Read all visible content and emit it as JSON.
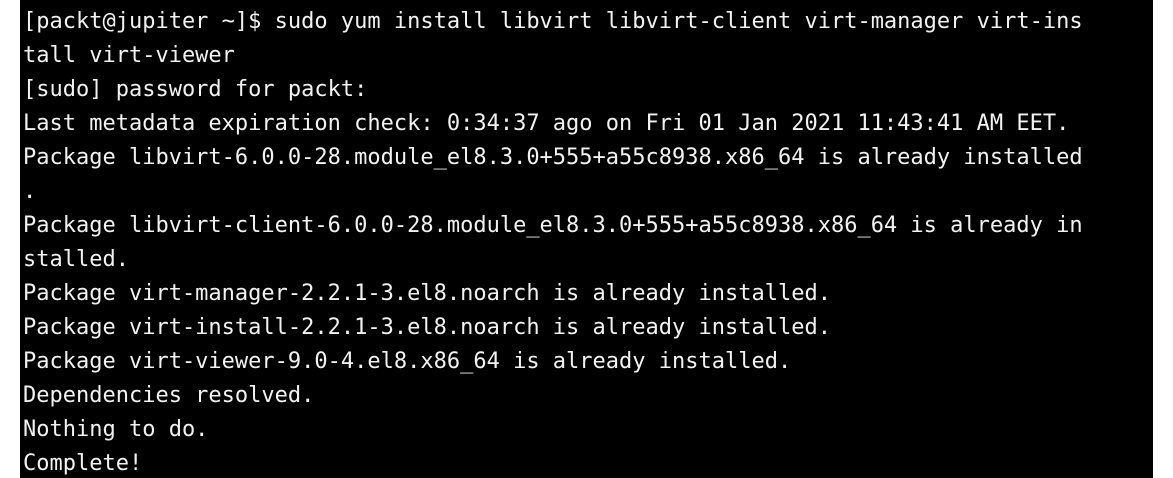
{
  "terminal": {
    "lines": [
      "[packt@jupiter ~]$ sudo yum install libvirt libvirt-client virt-manager virt-ins",
      "tall virt-viewer",
      "[sudo] password for packt:",
      "Last metadata expiration check: 0:34:37 ago on Fri 01 Jan 2021 11:43:41 AM EET.",
      "Package libvirt-6.0.0-28.module_el8.3.0+555+a55c8938.x86_64 is already installed",
      ".",
      "Package libvirt-client-6.0.0-28.module_el8.3.0+555+a55c8938.x86_64 is already in",
      "stalled.",
      "Package virt-manager-2.2.1-3.el8.noarch is already installed.",
      "Package virt-install-2.2.1-3.el8.noarch is already installed.",
      "Package virt-viewer-9.0-4.el8.x86_64 is already installed.",
      "Dependencies resolved.",
      "Nothing to do.",
      "Complete!"
    ],
    "colors": {
      "background": "#000000",
      "foreground": "#f2f2f2"
    }
  }
}
